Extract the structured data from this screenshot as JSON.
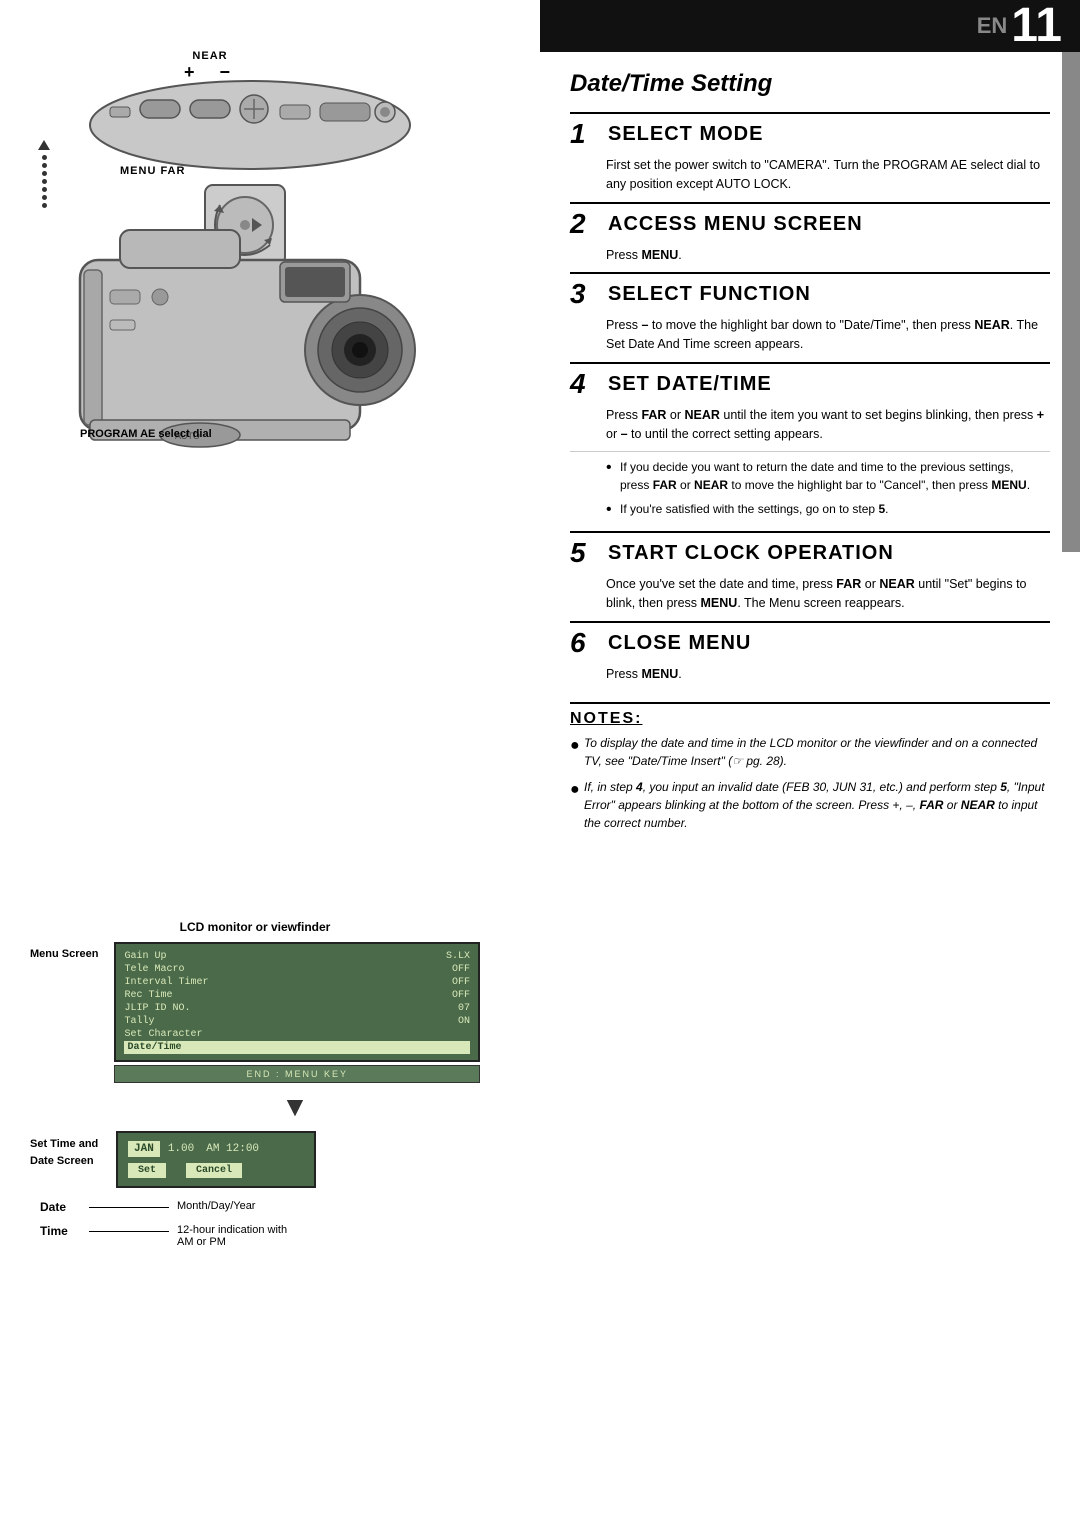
{
  "topbar": {
    "en_label": "EN",
    "page_number": "11"
  },
  "left": {
    "near_label": "NEAR",
    "plus_minus": "+ −",
    "menu_far_label": "MENU   FAR",
    "program_ae_label": "PROGRAM AE select dial",
    "lcd_title": "LCD monitor or viewfinder",
    "menu_screen_label": "Menu Screen",
    "lcd_rows": [
      {
        "label": "Gain Up",
        "value": "S.LX"
      },
      {
        "label": "Tele Macro",
        "value": "OFF"
      },
      {
        "label": "Interval Timer",
        "value": "OFF"
      },
      {
        "label": "Rec Time",
        "value": "OFF"
      },
      {
        "label": "JLIP ID NO.",
        "value": "07"
      },
      {
        "label": "Tally",
        "value": "ON"
      },
      {
        "label": "Set Character",
        "value": ""
      },
      {
        "label": "Date/Time",
        "value": "",
        "highlighted": true
      }
    ],
    "end_menu_key": "END : MENU KEY",
    "set_time_label": "Set Time and\nDate Screen",
    "set_time_jan": "JAN",
    "set_time_val1": "1.00",
    "set_time_am": "AM 12:00",
    "set_btn": "Set",
    "cancel_btn": "Cancel",
    "date_label": "Date",
    "date_desc": "Month/Day/Year",
    "time_label": "Time",
    "time_desc": "12-hour indication with\nAM or PM"
  },
  "right": {
    "page_title": "Date/Time Setting",
    "steps": [
      {
        "number": "1",
        "title": "Select Mode",
        "body": "First set the power switch to \"CAMERA\". Turn the PROGRAM AE select dial to any position except AUTO LOCK."
      },
      {
        "number": "2",
        "title": "Access Menu Screen",
        "body": "Press MENU."
      },
      {
        "number": "3",
        "title": "Select Function",
        "body": "Press – to move the highlight bar down to \"Date/Time\", then press NEAR. The Set Date And Time screen appears."
      },
      {
        "number": "4",
        "title": "Set Date/Time",
        "body": "Press FAR or NEAR until the item you want to set begins blinking, then press + or – to until the correct setting appears."
      },
      {
        "number": "5",
        "title": "Start Clock Operation",
        "body": "Once you've set the date and time, press FAR or NEAR until \"Set\" begins to blink, then press MENU. The Menu screen reappears."
      },
      {
        "number": "6",
        "title": "Close Menu",
        "body": "Press MENU."
      }
    ],
    "bullet_items": [
      "If you decide you want to return the date and time to the previous settings, press FAR or NEAR to move the highlight bar to \"Cancel\", then press MENU.",
      "If you're satisfied with the settings, go on to step 5."
    ],
    "notes_title": "NOTES:",
    "notes": [
      "To display the date and time in the LCD monitor or the viewfinder and on a connected TV, see \"Date/Time Insert\" (☞ pg. 28).",
      "If, in step 4, you input an invalid date (FEB 30, JUN 31, etc.) and perform step 5, \"Input Error\" appears blinking at the bottom of the screen. Press +, –, FAR or NEAR to input the correct number."
    ]
  }
}
